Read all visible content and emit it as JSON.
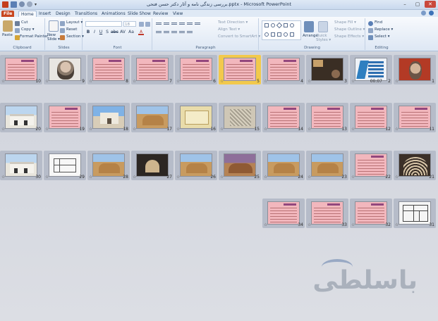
{
  "window": {
    "title": "بررسی زندگی نامه و آثار دکتر حسن فتحی.pptx - Microsoft PowerPoint",
    "qat_more": "▾",
    "controls": {
      "minimize": "–",
      "maximize": "▢",
      "close": "✕"
    }
  },
  "tabs": [
    "File",
    "Home",
    "Insert",
    "Design",
    "Transitions",
    "Animations",
    "Slide Show",
    "Review",
    "View"
  ],
  "active_tab": "Home",
  "ribbon": {
    "clipboard": {
      "paste": "Paste",
      "cut": "Cut",
      "copy": "Copy ▾",
      "format_painter": "Format Painter",
      "label": "Clipboard"
    },
    "slides": {
      "new_slide": "New Slide ▾",
      "layout": "Layout ▾",
      "reset": "Reset",
      "section": "Section ▾",
      "label": "Slides"
    },
    "font": {
      "size": "18",
      "label": "Font"
    },
    "paragraph": {
      "text_direction": "Text Direction ▾",
      "align_text": "Align Text ▾",
      "convert_smartart": "Convert to SmartArt ▾",
      "label": "Paragraph"
    },
    "drawing": {
      "arrange": "Arrange",
      "quick_styles": "Quick Styles ▾",
      "shape_fill": "Shape Fill ▾",
      "shape_outline": "Shape Outline ▾",
      "shape_effects": "Shape Effects ▾",
      "label": "Drawing"
    },
    "editing": {
      "find": "Find",
      "replace": "Replace ▾",
      "select": "Select ▾",
      "label": "Editing"
    }
  },
  "slides": [
    {
      "num": "1",
      "type": "photo-red"
    },
    {
      "num": "2",
      "type": "blue-diagram",
      "timing": "00:07"
    },
    {
      "num": "3",
      "type": "dark-photo"
    },
    {
      "num": "4",
      "type": "pink"
    },
    {
      "num": "5",
      "type": "pink",
      "selected": true
    },
    {
      "num": "6",
      "type": "pink"
    },
    {
      "num": "7",
      "type": "pink"
    },
    {
      "num": "8",
      "type": "pink"
    },
    {
      "num": "9",
      "type": "photo-portrait"
    },
    {
      "num": "10",
      "type": "pink"
    },
    {
      "num": "11",
      "type": "pink"
    },
    {
      "num": "12",
      "type": "pink"
    },
    {
      "num": "13",
      "type": "pink"
    },
    {
      "num": "14",
      "type": "pink"
    },
    {
      "num": "15",
      "type": "carved"
    },
    {
      "num": "16",
      "type": "tan-frame"
    },
    {
      "num": "17",
      "type": "sand"
    },
    {
      "num": "18",
      "type": "building"
    },
    {
      "num": "19",
      "type": "pink"
    },
    {
      "num": "20",
      "type": "white-bldg"
    },
    {
      "num": "21",
      "type": "dome-lattice"
    },
    {
      "num": "22",
      "type": "pink"
    },
    {
      "num": "23",
      "type": "sand"
    },
    {
      "num": "24",
      "type": "sand"
    },
    {
      "num": "25",
      "type": "dusk"
    },
    {
      "num": "26",
      "type": "sand"
    },
    {
      "num": "27",
      "type": "dark-room"
    },
    {
      "num": "28",
      "type": "sand"
    },
    {
      "num": "29",
      "type": "plan"
    },
    {
      "num": "30",
      "type": "white-bldg"
    },
    {
      "num": "31",
      "type": "plan2"
    },
    {
      "num": "32",
      "type": "pink"
    },
    {
      "num": "33",
      "type": "pink"
    },
    {
      "num": "34",
      "type": "pink"
    }
  ],
  "star_glyph": "☆",
  "watermark": {
    "text": "باسلطی"
  }
}
